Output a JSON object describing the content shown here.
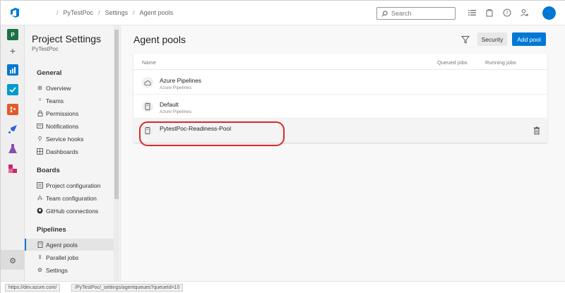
{
  "breadcrumb": {
    "project": "PyTestPoc",
    "settings": "Settings",
    "page": "Agent pools"
  },
  "search": {
    "placeholder": "Search"
  },
  "rail": {
    "project_initial": "P"
  },
  "settings_nav": {
    "title": "Project Settings",
    "subtitle": "PyTestPoc",
    "sections": {
      "general": "General",
      "boards": "Boards",
      "pipelines": "Pipelines"
    },
    "items": {
      "overview": "Overview",
      "teams": "Teams",
      "permissions": "Permissions",
      "notifications": "Notifications",
      "service_hooks": "Service hooks",
      "dashboards": "Dashboards",
      "project_configuration": "Project configuration",
      "team_configuration": "Team configuration",
      "github_connections": "GitHub connections",
      "agent_pools": "Agent pools",
      "parallel_jobs": "Parallel jobs",
      "settings": "Settings"
    }
  },
  "main": {
    "title": "Agent pools",
    "security_button": "Security",
    "add_pool_button": "Add pool",
    "columns": {
      "name": "Name",
      "queued": "Queued jobs",
      "running": "Running jobs"
    },
    "pools": [
      {
        "name": "Azure Pipelines",
        "sub": "Azure Pipelines"
      },
      {
        "name": "Default",
        "sub": "Azure Pipelines"
      },
      {
        "name": "PytestPoc-Readiness-Pool",
        "sub": ""
      }
    ]
  },
  "statusbar": {
    "url_host": "https://dev.azure.com/",
    "url_path": "/PyTestPoc/_settings/agentqueues?queueId=10"
  },
  "colors": {
    "accent": "#0078d4",
    "annotation": "#d72a2a"
  }
}
